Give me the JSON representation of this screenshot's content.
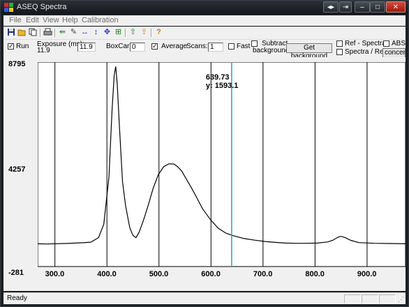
{
  "window": {
    "title": "ASEQ Spectra"
  },
  "menu": [
    "File",
    "Edit",
    "View",
    "Help",
    "Calibration"
  ],
  "toolbar_icons": [
    "save-icon",
    "open-folder-icon",
    "copy-icon",
    "print-icon",
    "export-icon",
    "wrench-icon",
    "horizontal-scale-icon",
    "vertical-scale-icon",
    "move-icon",
    "autoscale-icon",
    "up-arrow-icon",
    "load-icon",
    "help-icon"
  ],
  "controls": {
    "run_label": "Run",
    "run_checked": true,
    "exposure_label": "Exposure (ms):",
    "exposure_current": "11.9",
    "exposure_value": "11.9",
    "boxcar_label": "BoxCar:",
    "boxcar_value": "0",
    "average_label": "Average",
    "average_checked": true,
    "scans_label": "Scans:",
    "scans_value": "1",
    "fast_label": "Fast",
    "subtract_label_1": "Subtract",
    "subtract_label_2": "background",
    "get_background_label": "Get background",
    "ref_spectra_label": "Ref - Spectra",
    "spectra_ref_label": "Spectra / Ref",
    "abs_label": "ABS",
    "concentration_label": "concentr"
  },
  "plot": {
    "y_top_label": "8795",
    "y_mid_label": "4257",
    "y_bottom_label": "-281",
    "cursor_x_label": "639.73",
    "cursor_y_label": "y: 1593.1"
  },
  "chart_data": {
    "type": "line",
    "xlim": [
      283,
      990
    ],
    "ylim": [
      -281,
      8795
    ],
    "x_ticks": [
      "300.0",
      "400.0",
      "500.0",
      "600.0",
      "700.0",
      "800.0",
      "900.0"
    ],
    "x_tick_values": [
      300,
      400,
      500,
      600,
      700,
      800,
      900
    ],
    "y_ticks": [
      -281,
      4257,
      8795
    ],
    "cursor_x": 639.73,
    "cursor_y": 1593.1,
    "x": [
      283,
      300,
      340,
      370,
      385,
      400,
      410,
      420,
      426,
      430,
      433,
      436,
      440,
      446,
      452,
      460,
      466,
      472,
      478,
      486,
      495,
      505,
      515,
      525,
      535,
      545,
      552,
      560,
      570,
      580,
      590,
      600,
      615,
      630,
      645,
      660,
      680,
      700,
      720,
      740,
      760,
      780,
      800,
      820,
      840,
      850,
      860,
      866,
      874,
      885,
      900,
      930,
      960,
      990
    ],
    "values": [
      730,
      720,
      745,
      775,
      800,
      1000,
      1600,
      3700,
      6700,
      8200,
      8600,
      7800,
      6000,
      3500,
      2400,
      1450,
      1100,
      1000,
      1250,
      1750,
      2400,
      3200,
      3800,
      4150,
      4280,
      4270,
      4150,
      3950,
      3550,
      3150,
      2720,
      2280,
      1800,
      1420,
      1200,
      1080,
      960,
      890,
      830,
      790,
      760,
      750,
      750,
      760,
      810,
      880,
      1020,
      1060,
      1000,
      880,
      780,
      750,
      740,
      730
    ]
  },
  "status": {
    "text": "Ready"
  }
}
